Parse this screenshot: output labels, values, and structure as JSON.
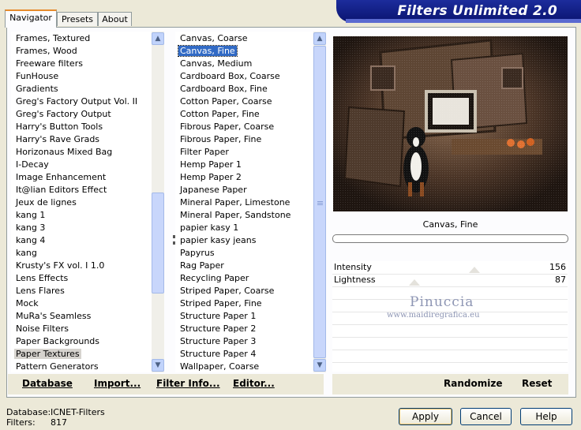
{
  "tabs": [
    {
      "label": "Navigator"
    },
    {
      "label": "Presets"
    },
    {
      "label": "About"
    }
  ],
  "banner": {
    "title": "Filters Unlimited 2.0"
  },
  "categories": {
    "items": [
      "Frames, Textured",
      "Frames, Wood",
      "Freeware filters",
      "FunHouse",
      "Gradients",
      "Greg's Factory Output Vol. II",
      "Greg's Factory Output",
      "Harry's Button Tools",
      "Harry's Rave Grads",
      "Horizonaus Mixed Bag",
      "I-Decay",
      "Image Enhancement",
      "It@lian Editors Effect",
      "Jeux de lignes",
      "kang 1",
      "kang 3",
      "kang 4",
      "kang",
      "Krusty's FX vol. I 1.0",
      "Lens Effects",
      "Lens Flares",
      "Mock",
      "MuRa's Seamless",
      "Noise Filters",
      "Paper Backgrounds",
      "Paper Textures",
      "Pattern Generators"
    ],
    "selected": "Paper Textures"
  },
  "filters": {
    "items": [
      "Canvas, Coarse",
      "Canvas, Fine",
      "Canvas, Medium",
      "Cardboard Box, Coarse",
      "Cardboard Box, Fine",
      "Cotton Paper, Coarse",
      "Cotton Paper, Fine",
      "Fibrous Paper, Coarse",
      "Fibrous Paper, Fine",
      "Filter Paper",
      "Hemp Paper 1",
      "Hemp Paper 2",
      "Japanese Paper",
      "Mineral Paper, Limestone",
      "Mineral Paper, Sandstone",
      "papier kasy 1",
      "papier kasy jeans",
      "Papyrus",
      "Rag Paper",
      "Recycling Paper",
      "Striped Paper, Coarse",
      "Striped Paper, Fine",
      "Structure Paper 1",
      "Structure Paper 2",
      "Structure Paper 3",
      "Structure Paper 4",
      "Wallpaper, Coarse"
    ],
    "selected": "Canvas, Fine"
  },
  "preview": {
    "filter_name": "Canvas, Fine",
    "progress": 0
  },
  "params": [
    {
      "label": "Intensity",
      "value": "156",
      "fraction": 0.61
    },
    {
      "label": "Lightness",
      "value": "87",
      "fraction": 0.34
    }
  ],
  "watermark": {
    "line1": "Pinuccia",
    "line2": "www.maidiregrafica.eu"
  },
  "toolbar": {
    "database": "Database",
    "import": "Import...",
    "filter_info": "Filter Info...",
    "editor": "Editor...",
    "randomize": "Randomize",
    "reset": "Reset"
  },
  "status": {
    "database_label": "Database:",
    "database_value": "ICNET-Filters",
    "filters_label": "Filters:",
    "filters_value": "817"
  },
  "buttons": {
    "apply": "Apply",
    "cancel": "Cancel",
    "help": "Help"
  },
  "colors": {
    "selection": "#316ac5",
    "banner": "#0a1470",
    "accent": "#e68b2c"
  }
}
